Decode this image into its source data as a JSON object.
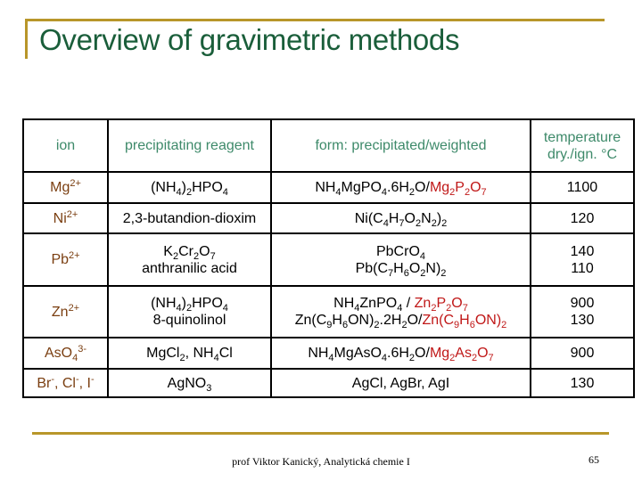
{
  "slide": {
    "title": "Overview of gravimetric methods",
    "colors": {
      "accent_bar": "#b8962a",
      "title": "#1a5e3a",
      "header_text": "#3e8a6a",
      "ion_text": "#7a3e10",
      "weighted_form": "#c01818"
    }
  },
  "table": {
    "headers": {
      "ion": "ion",
      "reagent": "precipitating reagent",
      "form": "form: precipitated/weighted",
      "temp_line1": "temperature",
      "temp_line2": "dry./ign. °C"
    },
    "rows": [
      {
        "ion": "Mg²⁺",
        "reagent": [
          "(NH4)2HPO4"
        ],
        "form": [
          "NH4MgPO4.6H2O/Mg2P2O7"
        ],
        "temperature": [
          "1100"
        ]
      },
      {
        "ion": "Ni²⁺",
        "reagent": [
          "2,3-butandion-dioxim"
        ],
        "form": [
          "Ni(C4H7O2N2)2"
        ],
        "temperature": [
          "120"
        ]
      },
      {
        "ion": "Pb²⁺",
        "reagent": [
          "K2Cr2O7",
          "anthranilic acid"
        ],
        "form": [
          "PbCrO4",
          "Pb(C7H6O2N)2"
        ],
        "temperature": [
          "140",
          "110"
        ]
      },
      {
        "ion": "Zn²⁺",
        "reagent": [
          "(NH4)2HPO4",
          "8-quinolinol"
        ],
        "form": [
          "NH4ZnPO4 / Zn2P2O7",
          "Zn(C9H6ON)2.2H2O/Zn(C9H6ON)2"
        ],
        "temperature": [
          "900",
          "130"
        ]
      },
      {
        "ion": "AsO4³⁻",
        "reagent": [
          "MgCl2, NH4Cl"
        ],
        "form": [
          "NH4MgAsO4.6H2O/Mg2As2O7"
        ],
        "temperature": [
          "900"
        ]
      },
      {
        "ion": "Br⁻, Cl⁻, I⁻",
        "reagent": [
          "AgNO3"
        ],
        "form": [
          "AgCl, AgBr, AgI"
        ],
        "temperature": [
          "130"
        ]
      }
    ]
  },
  "footer": {
    "author": "prof Viktor Kanický, Analytická chemie I",
    "page_number": "65"
  }
}
